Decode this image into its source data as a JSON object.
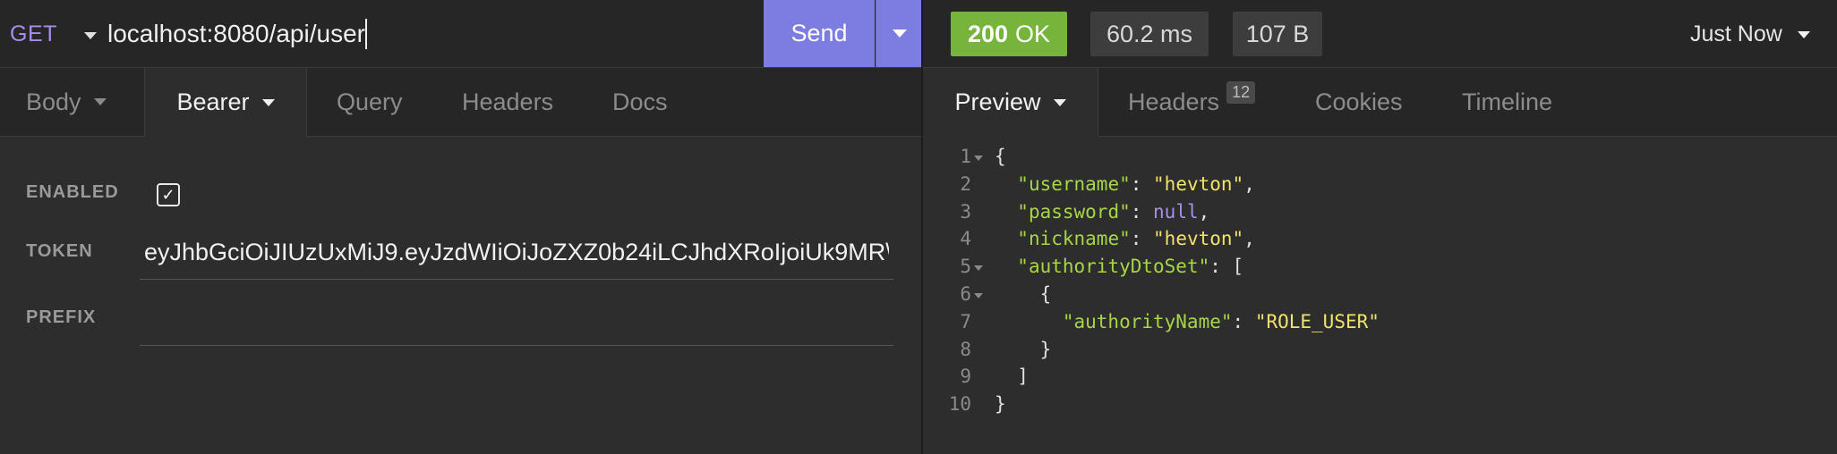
{
  "request": {
    "method": "GET",
    "url": "localhost:8080/api/user",
    "send_label": "Send",
    "tabs": [
      {
        "label": "Body"
      },
      {
        "label": "Bearer"
      },
      {
        "label": "Query"
      },
      {
        "label": "Headers"
      },
      {
        "label": "Docs"
      }
    ],
    "auth": {
      "enabled_label": "ENABLED",
      "enabled": true,
      "token_label": "TOKEN",
      "token_value": "eyJhbGciOiJIUzUxMiJ9.eyJzdWIiOiJoZXZ0b24iLCJhdXRoIjoiUk9MR\\",
      "prefix_label": "PREFIX",
      "prefix_value": ""
    }
  },
  "response": {
    "status_code": "200",
    "status_text": "OK",
    "time": "60.2 ms",
    "size": "107 B",
    "history": "Just Now",
    "tabs": [
      {
        "label": "Preview"
      },
      {
        "label": "Headers",
        "badge": "12"
      },
      {
        "label": "Cookies"
      },
      {
        "label": "Timeline"
      }
    ],
    "lines": [
      {
        "n": "1",
        "indent": "",
        "key": "",
        "value": "",
        "text": "{"
      },
      {
        "n": "2",
        "indent": "  ",
        "key": "\"username\"",
        "value": "\"hevton\"",
        "vtype": "s",
        "text": ","
      },
      {
        "n": "3",
        "indent": "  ",
        "key": "\"password\"",
        "value": "null",
        "vtype": "n",
        "text": ","
      },
      {
        "n": "4",
        "indent": "  ",
        "key": "\"nickname\"",
        "value": "\"hevton\"",
        "vtype": "s",
        "text": ","
      },
      {
        "n": "5",
        "indent": "  ",
        "key": "\"authorityDtoSet\"",
        "value": "",
        "text": ": ["
      },
      {
        "n": "6",
        "indent": "    ",
        "key": "",
        "value": "",
        "text": "{"
      },
      {
        "n": "7",
        "indent": "      ",
        "key": "\"authorityName\"",
        "value": "\"ROLE_USER\"",
        "vtype": "s",
        "text": ""
      },
      {
        "n": "8",
        "indent": "    ",
        "key": "",
        "value": "",
        "text": "}"
      },
      {
        "n": "9",
        "indent": "  ",
        "key": "",
        "value": "",
        "text": "]"
      },
      {
        "n": "10",
        "indent": "",
        "key": "",
        "value": "",
        "text": "}"
      }
    ]
  },
  "colors": {
    "accent": "#7d7ce0",
    "status_ok": "#77b43c",
    "json_key": "#a6d646",
    "json_string": "#f0e36a",
    "json_null": "#a88cf0"
  }
}
